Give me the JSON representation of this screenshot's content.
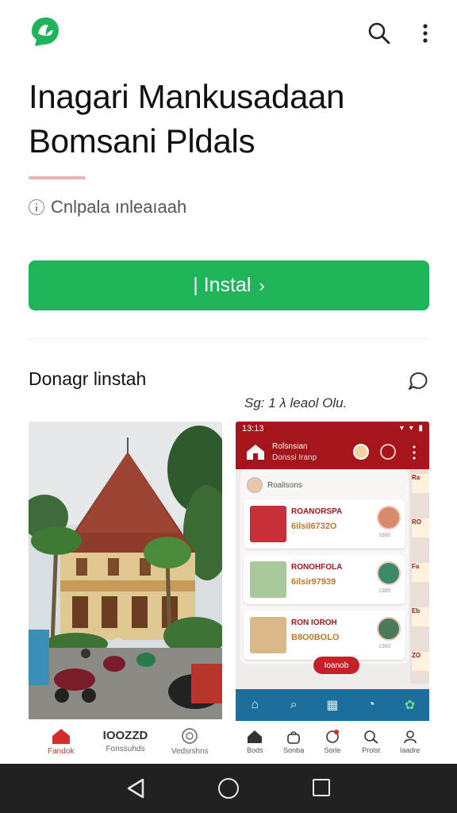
{
  "app": {
    "title": "Inagari Mankusadaan Bomsani Pldals",
    "info_text": "Cnlpala ınleaıaah",
    "install_label": "| Instal",
    "install_chevron": "›",
    "brand_color": "#1fb45a"
  },
  "section": {
    "title": "Donagr linstah",
    "caption": "Sg: 1 λ leaol Olu."
  },
  "left_screenshot": {
    "nav": [
      {
        "icon": "home-icon",
        "label": "Fandok",
        "active": true
      },
      {
        "icon": "text",
        "glyph": "IOOZZD",
        "label": "Fonssuhds"
      },
      {
        "icon": "circle-icon",
        "label": "Vedsrshns"
      }
    ]
  },
  "right_screenshot": {
    "status_time": "13:13",
    "status_icons": "▾ ▾ ▮",
    "header_line1": "Rofsnsian",
    "header_line2": "Donssi Iranp",
    "panel_head": "Roalisons",
    "cards": [
      {
        "name": "ROANORSPA",
        "number": "6ilsil6732O",
        "small": "1880"
      },
      {
        "name": "RONOHFOLA",
        "number": "6ilsir97939",
        "small": "1380"
      },
      {
        "name": "RON IOROH",
        "number": "B8O0BOLO",
        "small": "1360"
      }
    ],
    "side_labels": [
      "Ra",
      "RO",
      "Fa",
      "Eb",
      "ZO"
    ],
    "fab_label": "Ioanob",
    "bottom_nav": [
      {
        "icon": "home-icon",
        "label": "Bods"
      },
      {
        "icon": "bag-icon",
        "label": "Sonba"
      },
      {
        "icon": "refresh-icon",
        "label": "Sorle"
      },
      {
        "icon": "search-icon",
        "label": "Prolst"
      },
      {
        "icon": "person-icon",
        "label": "Iaadre"
      }
    ],
    "accent_color": "#a6141c",
    "bar_color": "#1c6f9c"
  }
}
